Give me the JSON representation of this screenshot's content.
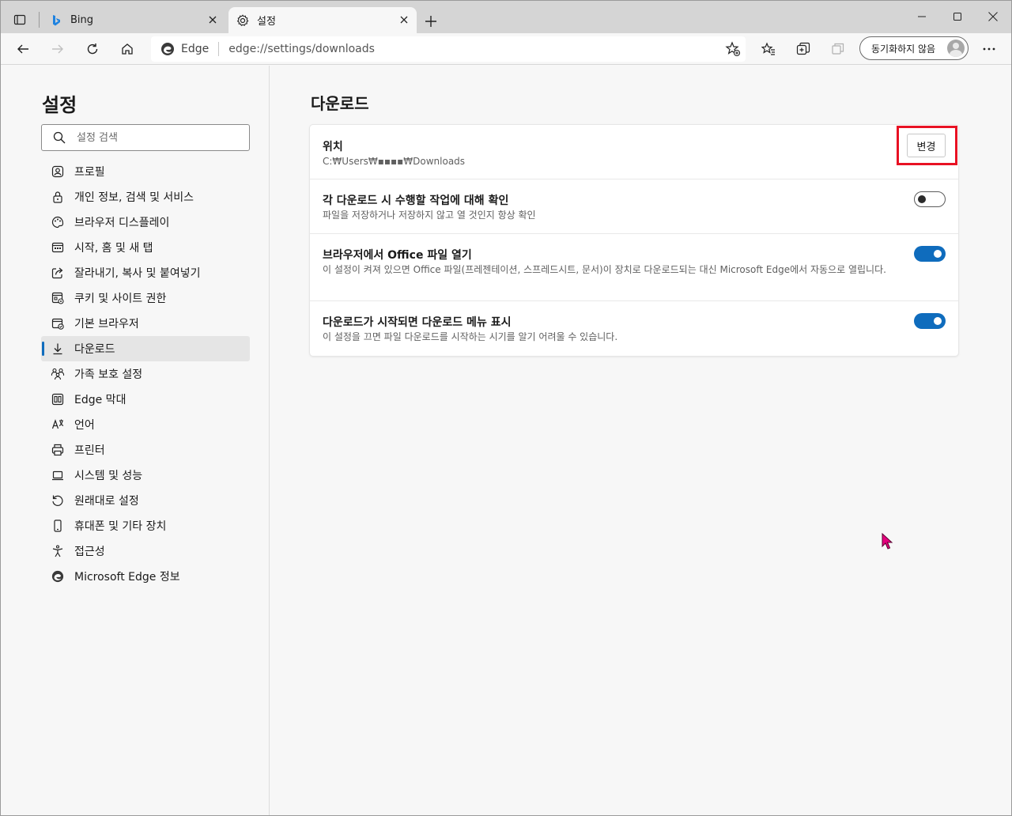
{
  "tabs": [
    {
      "label": "Bing",
      "icon": "bing-icon"
    },
    {
      "label": "설정",
      "icon": "gear-icon"
    }
  ],
  "address": {
    "brand": "Edge",
    "url": "edge://settings/downloads"
  },
  "profile": {
    "sync_label": "동기화하지 않음"
  },
  "sidebar": {
    "title": "설정",
    "search_placeholder": "설정 검색",
    "items": [
      {
        "label": "프로필",
        "icon": "profile-icon"
      },
      {
        "label": "개인 정보, 검색 및 서비스",
        "icon": "lock-icon"
      },
      {
        "label": "브라우저 디스플레이",
        "icon": "palette-icon"
      },
      {
        "label": "시작, 홈 및 새 탭",
        "icon": "home-tab-icon"
      },
      {
        "label": "잘라내기, 복사 및 붙여넣기",
        "icon": "share-icon"
      },
      {
        "label": "쿠키 및 사이트 권한",
        "icon": "site-permissions-icon"
      },
      {
        "label": "기본 브라우저",
        "icon": "default-browser-icon"
      },
      {
        "label": "다운로드",
        "icon": "download-icon",
        "active": true
      },
      {
        "label": "가족 보호 설정",
        "icon": "family-icon"
      },
      {
        "label": "Edge 막대",
        "icon": "edge-bar-icon"
      },
      {
        "label": "언어",
        "icon": "language-icon"
      },
      {
        "label": "프린터",
        "icon": "printer-icon"
      },
      {
        "label": "시스템 및 성능",
        "icon": "laptop-icon"
      },
      {
        "label": "원래대로 설정",
        "icon": "reset-icon"
      },
      {
        "label": "휴대폰 및 기타 장치",
        "icon": "phone-icon"
      },
      {
        "label": "접근성",
        "icon": "accessibility-icon"
      },
      {
        "label": "Microsoft Edge 정보",
        "icon": "edge-logo-icon"
      }
    ]
  },
  "main": {
    "title": "다운로드",
    "location": {
      "title": "위치",
      "path": "C:₩Users₩▪▪▪▪₩Downloads",
      "button": "변경"
    },
    "settings": [
      {
        "title": "각 다운로드 시 수행할 작업에 대해 확인",
        "desc": "파일을 저장하거나 저장하지 않고 열 것인지 항상 확인",
        "enabled": false
      },
      {
        "title": "브라우저에서 Office 파일 열기",
        "desc": "이 설정이 켜져 있으면 Office 파일(프레젠테이션, 스프레드시트, 문서)이 장치로 다운로드되는 대신 Microsoft Edge에서 자동으로 열립니다.",
        "enabled": true
      },
      {
        "title": "다운로드가 시작되면 다운로드 메뉴 표시",
        "desc": "이 설정을 끄면 파일 다운로드를 시작하는 시기를 알기 어려울 수 있습니다.",
        "enabled": true
      }
    ]
  },
  "colors": {
    "accent": "#0f6cbd",
    "highlight": "#e81123",
    "cursor": "#e6007e"
  }
}
